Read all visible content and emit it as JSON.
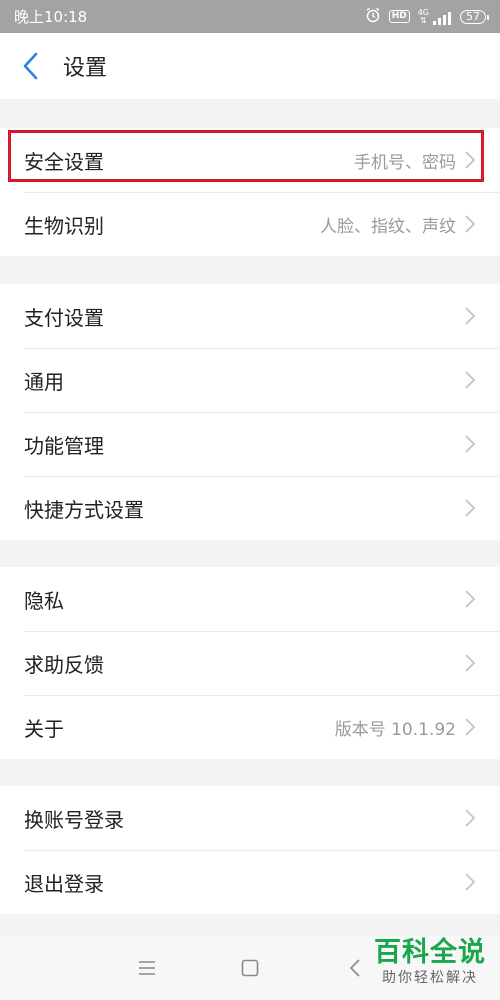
{
  "status_bar": {
    "time": "晚上10:18",
    "hd_badge": "HD",
    "network": "4G",
    "battery": "57"
  },
  "header": {
    "title": "设置"
  },
  "groups": [
    {
      "items": [
        {
          "label": "安全设置",
          "value": "手机号、密码"
        },
        {
          "label": "生物识别",
          "value": "人脸、指纹、声纹"
        }
      ]
    },
    {
      "items": [
        {
          "label": "支付设置",
          "value": ""
        },
        {
          "label": "通用",
          "value": ""
        },
        {
          "label": "功能管理",
          "value": ""
        },
        {
          "label": "快捷方式设置",
          "value": ""
        }
      ]
    },
    {
      "items": [
        {
          "label": "隐私",
          "value": ""
        },
        {
          "label": "求助反馈",
          "value": ""
        },
        {
          "label": "关于",
          "value": "版本号 10.1.92"
        }
      ]
    },
    {
      "items": [
        {
          "label": "换账号登录",
          "value": ""
        },
        {
          "label": "退出登录",
          "value": ""
        }
      ]
    }
  ],
  "watermark": {
    "title": "百科全说",
    "subtitle": "助你轻松解决"
  },
  "colors": {
    "accent": "#2f7fe0",
    "highlight": "#d3192a",
    "watermark": "#1aa64a",
    "chevron": "#c4c4c4"
  }
}
